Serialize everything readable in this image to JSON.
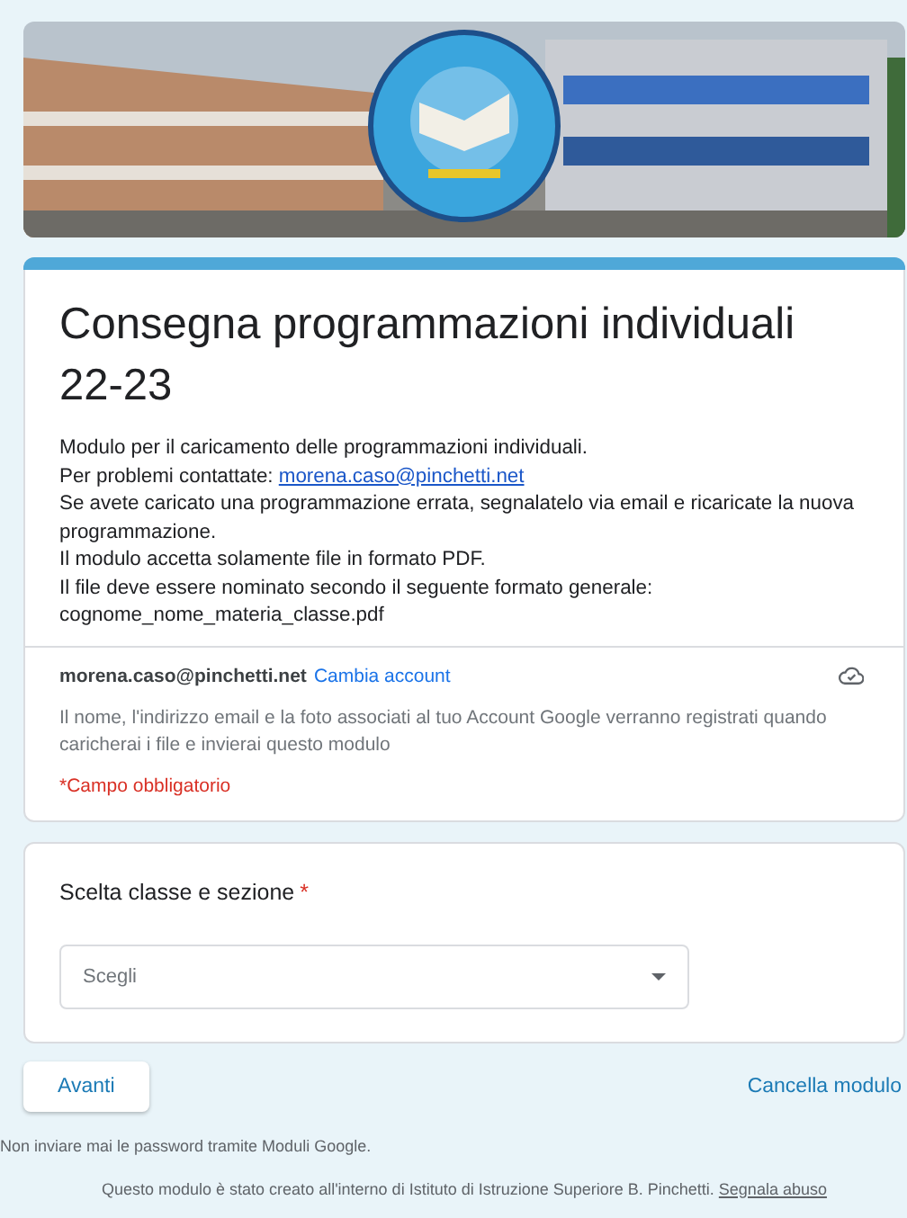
{
  "form": {
    "title": "Consegna programmazioni individuali 22-23",
    "description": [
      {
        "text": "Modulo per il caricamento delle programmazioni individuali."
      },
      {
        "text": "Per problemi contattate: ",
        "link": "morena.caso@pinchetti.net"
      },
      {
        "text": "Se avete caricato una programmazione errata, segnalatelo via email e ricaricate la nuova programmazione."
      },
      {
        "text": "Il modulo accetta solamente file in formato PDF."
      },
      {
        "text": "Il file deve essere nominato secondo il seguente formato generale:"
      },
      {
        "text": "cognome_nome_materia_classe.pdf"
      }
    ],
    "account": {
      "email": "morena.caso@pinchetti.net",
      "switch_link": "Cambia account",
      "notice": "Il nome, l'indirizzo email e la foto associati al tuo Account Google verranno registrati quando caricherai i file e invierai questo modulo"
    },
    "required_note": "*Campo obbligatorio"
  },
  "question": {
    "label": "Scelta classe e sezione",
    "required": true,
    "required_mark": "*",
    "placeholder": "Scegli"
  },
  "actions": {
    "next": "Avanti",
    "clear": "Cancella modulo"
  },
  "footer": {
    "warning": "Non inviare mai le password tramite Moduli Google.",
    "credit": "Questo modulo è stato creato all'interno di Istituto di Istruzione Superiore B. Pinchetti.",
    "report_link": "Segnala abuso"
  }
}
